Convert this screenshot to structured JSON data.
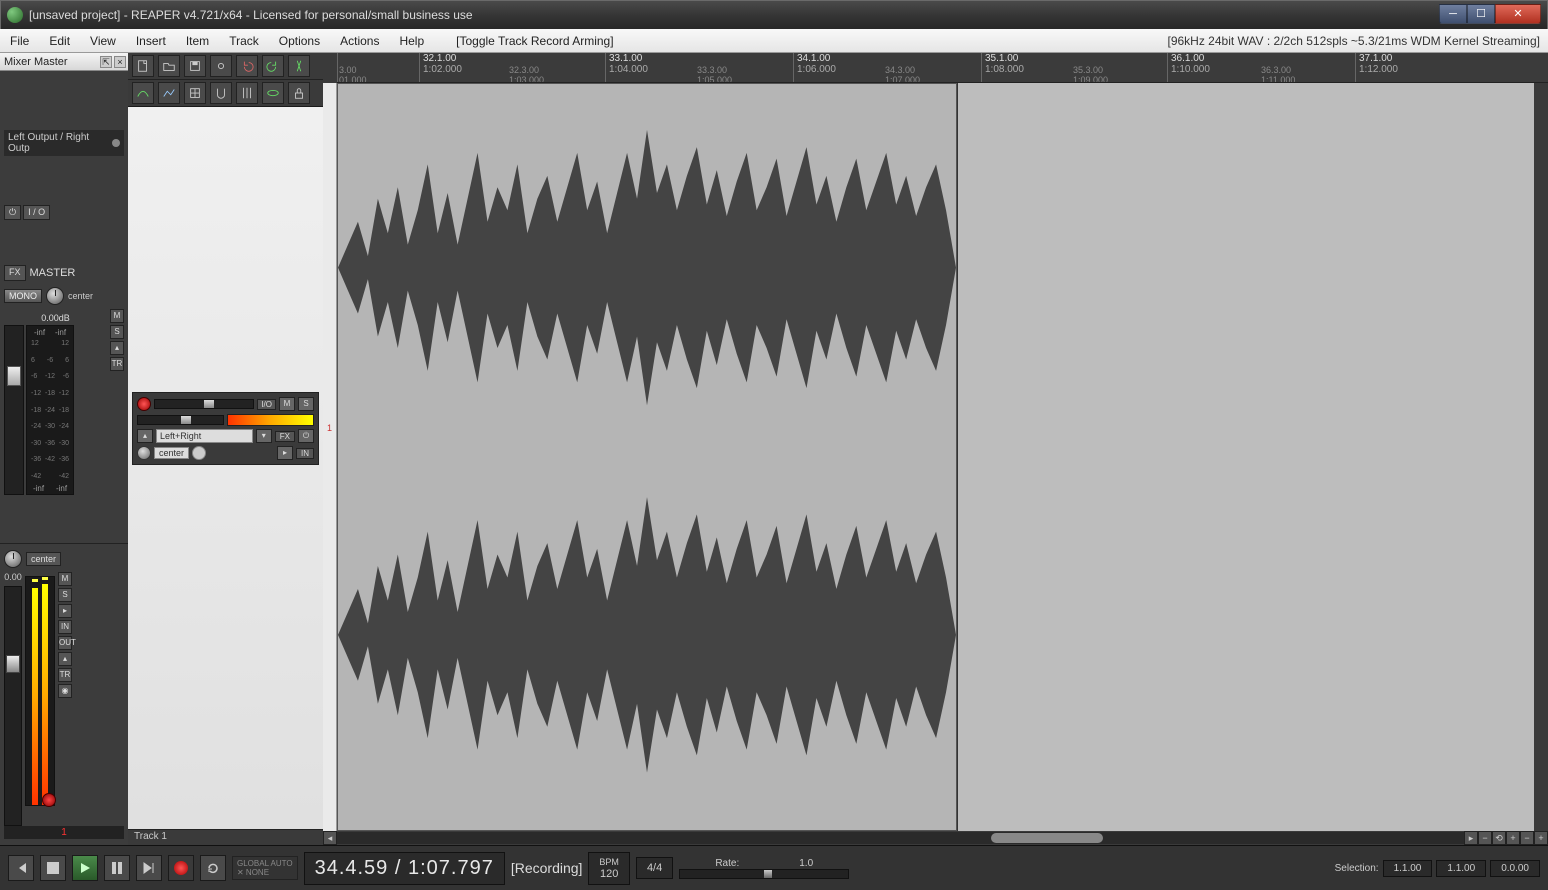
{
  "titlebar": {
    "text": "[unsaved project] - REAPER v4.721/x64 - Licensed for personal/small business use"
  },
  "window_buttons": {
    "min": "─",
    "max": "☐",
    "close": "✕"
  },
  "menu": {
    "items": [
      "File",
      "Edit",
      "View",
      "Insert",
      "Item",
      "Track",
      "Options",
      "Actions",
      "Help"
    ],
    "toggle": "[Toggle Track Record Arming]",
    "status": "[96kHz 24bit WAV : 2/2ch 512spls ~5.3/21ms WDM Kernel Streaming]"
  },
  "mixer": {
    "header": "Mixer Master",
    "routing": "Left Output / Right Outp",
    "io_power": "⏻",
    "io_label": "I / O",
    "fx_label": "FX",
    "master": "MASTER",
    "mono": "MONO",
    "center": "center",
    "db": "0.00dB",
    "inf_top_l": "-inf",
    "inf_top_r": "-inf",
    "inf_bot_l": "-inf",
    "inf_bot_r": "-inf",
    "scale": [
      "12",
      "6",
      "-6",
      "-12",
      "-18",
      "-24",
      "-30",
      "-36",
      "-42"
    ],
    "btns": {
      "m": "M",
      "s": "S",
      "env": "▴",
      "tr": "TR"
    }
  },
  "trackctrl": {
    "center": "center",
    "db": "0.00",
    "btns": {
      "m": "M",
      "s": "S",
      "play": "▸",
      "in": "IN",
      "out": "OUT",
      "env": "▴",
      "tr": "TR",
      "fx": "◉"
    },
    "number": "1"
  },
  "tcp": {
    "io": "I/O",
    "m": "M",
    "s": "S",
    "lr": "Left+Right",
    "fx": "FX",
    "fxb": "⏻",
    "center": "center",
    "in": "IN",
    "play": "▸",
    "track_label": "Track 1"
  },
  "ruler": {
    "major": [
      {
        "bar": "",
        "time": "",
        "pos": 0
      },
      {
        "bar": "32.1.00",
        "time": "1:02.000",
        "pos": 82
      },
      {
        "bar": "33.1.00",
        "time": "1:04.000",
        "pos": 268
      },
      {
        "bar": "34.1.00",
        "time": "1:06.000",
        "pos": 456
      },
      {
        "bar": "35.1.00",
        "time": "1:08.000",
        "pos": 644
      },
      {
        "bar": "36.1.00",
        "time": "1:10.000",
        "pos": 830
      },
      {
        "bar": "37.1.00",
        "time": "1:12.000",
        "pos": 1018
      }
    ],
    "minor": [
      {
        "bar": "3.00",
        "time": "01.000",
        "pos": 2
      },
      {
        "bar": "32.3.00",
        "time": "1:03.000",
        "pos": 172
      },
      {
        "bar": "33.3.00",
        "time": "1:05.000",
        "pos": 360
      },
      {
        "bar": "34.3.00",
        "time": "1:07.000",
        "pos": 548
      },
      {
        "bar": "35.3.00",
        "time": "1:09.000",
        "pos": 736
      },
      {
        "bar": "36.3.00",
        "time": "1:11.000",
        "pos": 924
      }
    ]
  },
  "transport": {
    "global_auto": "GLOBAL AUTO",
    "global_auto_v": "✕  NONE",
    "time": "34.4.59 / 1:07.797",
    "status": "[Recording]",
    "bpm_label": "BPM",
    "bpm": "120",
    "sig": "4/4",
    "rate_label": "Rate:",
    "rate": "1.0",
    "sel_label": "Selection:",
    "sel_start": "1.1.00",
    "sel_end": "1.1.00",
    "sel_len": "0.0.00"
  },
  "hscroll": {
    "left": "◂",
    "right": "▸",
    "plus": "+",
    "minus": "−",
    "home": "⟲"
  }
}
